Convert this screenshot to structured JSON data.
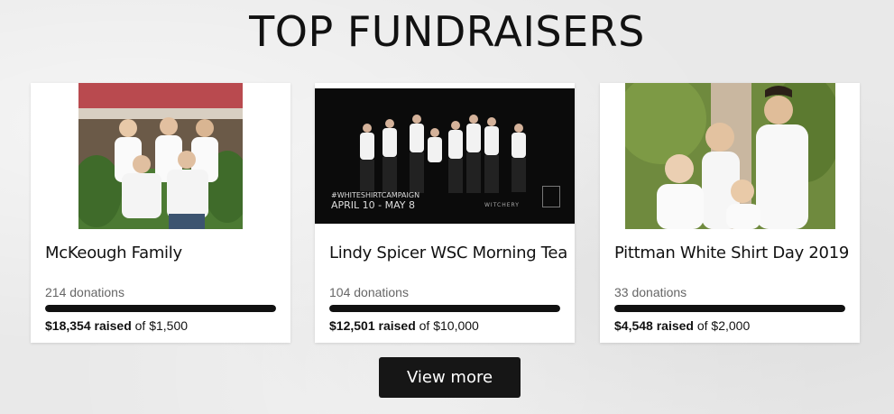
{
  "section": {
    "title": "TOP FUNDRAISERS"
  },
  "fundraisers": [
    {
      "name": "McKeough Family",
      "donations": "214 donations",
      "raised": "$18,354 raised",
      "goal_text": "of $1,500",
      "progress": 1.0
    },
    {
      "name": "Lindy Spicer WSC Morning Tea",
      "donations": "104 donations",
      "raised": "$12,501 raised",
      "goal_text": "of $10,000",
      "progress": 1.0,
      "banner": {
        "hashtag": "#WHITESHIRTCAMPAIGN",
        "dates": "APRIL 10 - MAY 8",
        "brand": "WITCHERY"
      }
    },
    {
      "name": "Pittman White Shirt Day 2019",
      "donations": "33 donations",
      "raised": "$4,548 raised",
      "goal_text": "of $2,000",
      "progress": 1.0
    }
  ],
  "actions": {
    "view_more": "View more"
  },
  "colors": {
    "accent": "#161616",
    "bar": "#111111",
    "background": "#e9e9e9"
  }
}
